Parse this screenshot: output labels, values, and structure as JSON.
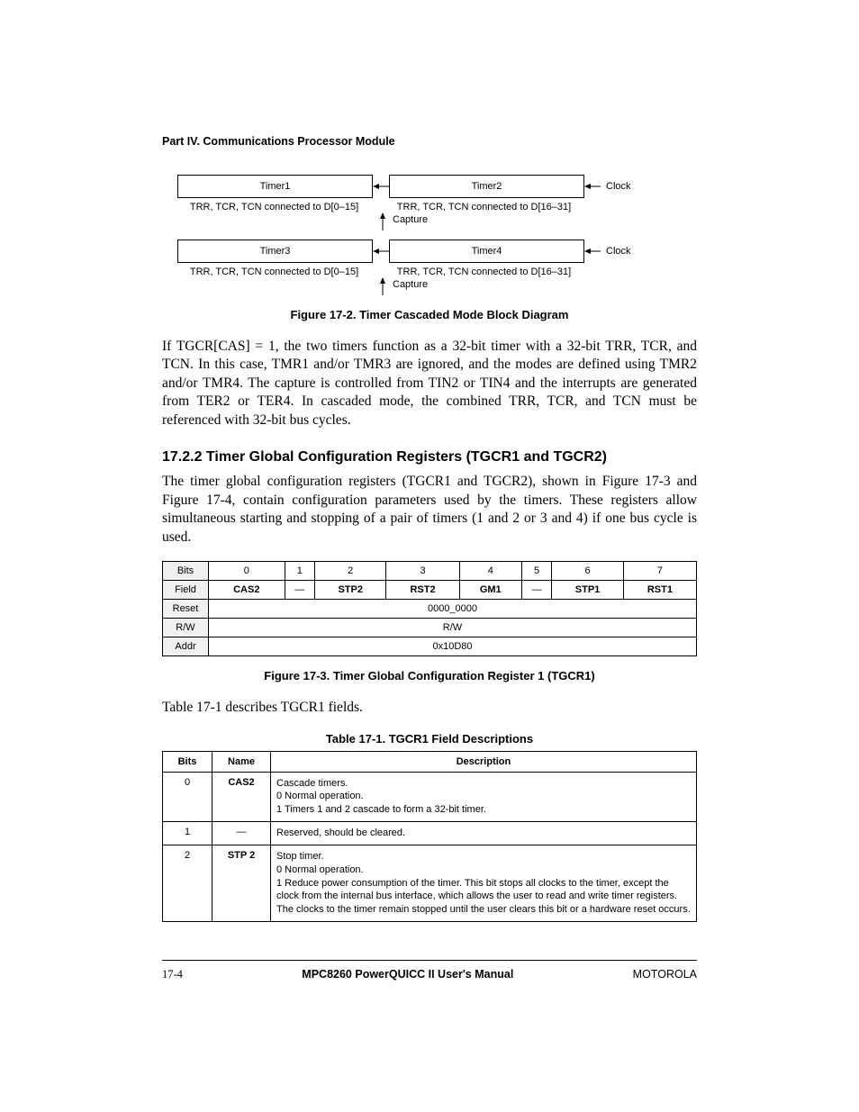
{
  "part_header": "Part IV.  Communications Processor Module",
  "diagram": {
    "row1": {
      "left": "Timer1",
      "right": "Timer2",
      "clock": "Clock"
    },
    "sub1": {
      "left": "TRR, TCR, TCN connected to D[0–15]",
      "right": "TRR, TCR, TCN connected to D[16–31]"
    },
    "capture": "Capture",
    "row2": {
      "left": "Timer3",
      "right": "Timer4",
      "clock": "Clock"
    },
    "sub2": {
      "left": "TRR, TCR, TCN connected to D[0–15]",
      "right": "TRR, TCR, TCN connected to D[16–31]"
    },
    "fig_caption": "Figure 17-2. Timer Cascaded Mode Block Diagram"
  },
  "para1": "If TGCR[CAS] = 1, the two timers function as a 32-bit timer with a 32-bit TRR, TCR, and TCN. In this case, TMR1 and/or TMR3 are ignored, and the modes are defined using TMR2 and/or TMR4. The capture is controlled from TIN2 or TIN4 and the interrupts are generated from TER2 or TER4. In cascaded mode, the combined TRR, TCR, and TCN must be referenced with 32-bit bus cycles.",
  "sec_head": "17.2.2  Timer Global Configuration Registers (TGCR1 and TGCR2)",
  "para2": "The timer global configuration registers (TGCR1 and TGCR2), shown in Figure 17-3 and Figure 17-4, contain configuration parameters used by the timers. These registers allow simultaneous starting and stopping of a pair of timers (1 and 2 or 3 and 4) if one bus cycle is used.",
  "reg": {
    "labels": {
      "bits": "Bits",
      "field": "Field",
      "reset": "Reset",
      "rw": "R/W",
      "addr": "Addr"
    },
    "bits": [
      "0",
      "1",
      "2",
      "3",
      "4",
      "5",
      "6",
      "7"
    ],
    "fields": [
      "CAS2",
      "—",
      "STP2",
      "RST2",
      "GM1",
      "—",
      "STP1",
      "RST1"
    ],
    "reset": "0000_0000",
    "rw": "R/W",
    "addr": "0x10D80",
    "caption": "Figure 17-3. Timer Global Configuration Register 1 (TGCR1)"
  },
  "para3": "Table 17-1 describes TGCR1 fields.",
  "table": {
    "caption": "Table 17-1. TGCR1 Field Descriptions",
    "head": {
      "bits": "Bits",
      "name": "Name",
      "desc": "Description"
    },
    "rows": [
      {
        "bits": "0",
        "name": "CAS2",
        "desc": "Cascade timers.\n0 Normal operation.\n1 Timers 1 and 2 cascade to form a 32-bit timer."
      },
      {
        "bits": "1",
        "name": "—",
        "desc": "Reserved, should be cleared."
      },
      {
        "bits": "2",
        "name": "STP 2",
        "desc": "Stop timer.\n0 Normal operation.\n1 Reduce power consumption of the timer. This bit stops all clocks to the timer, except the clock from the internal bus interface, which allows the user to read and write timer registers. The clocks to the timer remain stopped until the user clears this bit or a hardware reset occurs."
      }
    ]
  },
  "footer": {
    "left": "17-4",
    "mid": "MPC8260 PowerQUICC II User's Manual",
    "right": "MOTOROLA"
  }
}
